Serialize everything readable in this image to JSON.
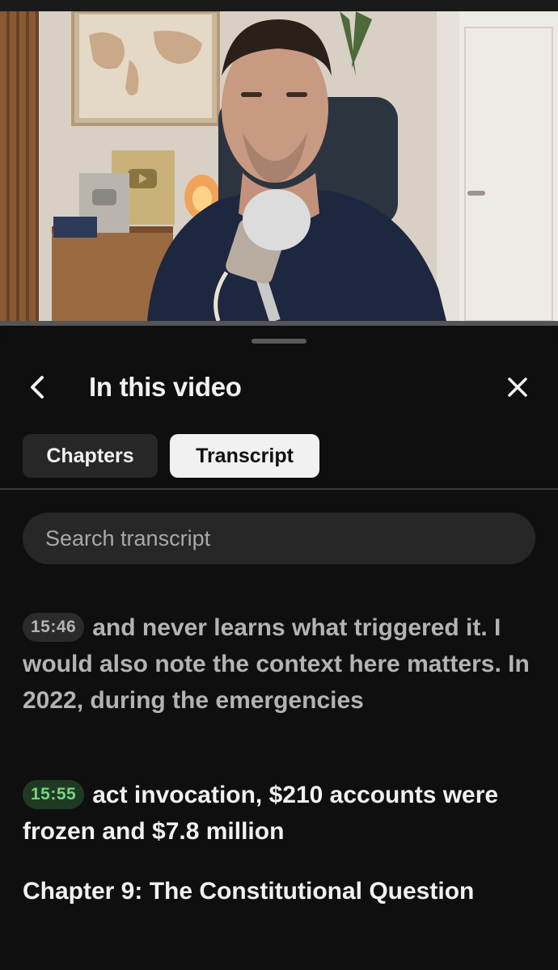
{
  "panel": {
    "title": "In this video",
    "back_icon": "chevron-left-icon",
    "close_icon": "close-icon"
  },
  "tabs": [
    {
      "label": "Chapters",
      "selected": false
    },
    {
      "label": "Transcript",
      "selected": true
    }
  ],
  "search": {
    "placeholder": "Search transcript"
  },
  "transcript": [
    {
      "timestamp": "15:46",
      "text": "and never learns what triggered it. I would also note the context here matters. In 2022, during the emergencies",
      "active": false
    },
    {
      "timestamp": "15:55",
      "text": "act invocation, $210 accounts were frozen and $7.8 million",
      "active": true
    }
  ],
  "chapter_heading": "Chapter 9: The Constitutional Question",
  "video": {
    "progress_fraction": 0.0
  },
  "colors": {
    "background": "#0f0f0f",
    "chip_bg": "#272727",
    "active_timestamp_bg": "#1f3a22",
    "active_timestamp_text": "#79d184"
  }
}
